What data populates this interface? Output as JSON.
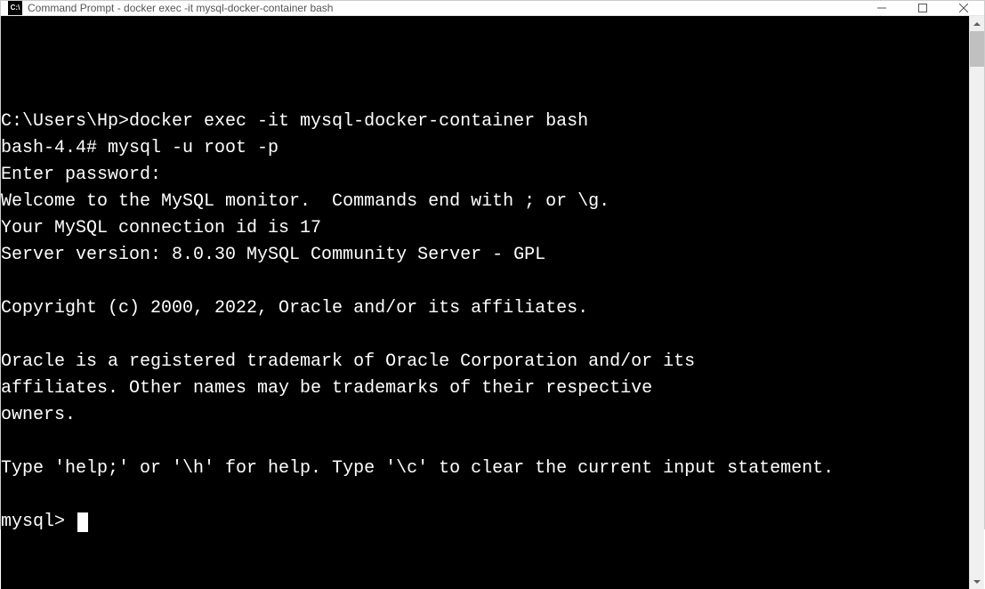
{
  "window": {
    "title": "Command Prompt - docker  exec -it mysql-docker-container bash",
    "icon_label": "C:\\"
  },
  "terminal": {
    "lines": [
      "C:\\Users\\Hp>docker exec -it mysql-docker-container bash",
      "bash-4.4# mysql -u root -p",
      "Enter password:",
      "Welcome to the MySQL monitor.  Commands end with ; or \\g.",
      "Your MySQL connection id is 17",
      "Server version: 8.0.30 MySQL Community Server - GPL",
      "",
      "Copyright (c) 2000, 2022, Oracle and/or its affiliates.",
      "",
      "Oracle is a registered trademark of Oracle Corporation and/or its",
      "affiliates. Other names may be trademarks of their respective",
      "owners.",
      "",
      "Type 'help;' or '\\h' for help. Type '\\c' to clear the current input statement.",
      ""
    ],
    "prompt": "mysql> "
  }
}
